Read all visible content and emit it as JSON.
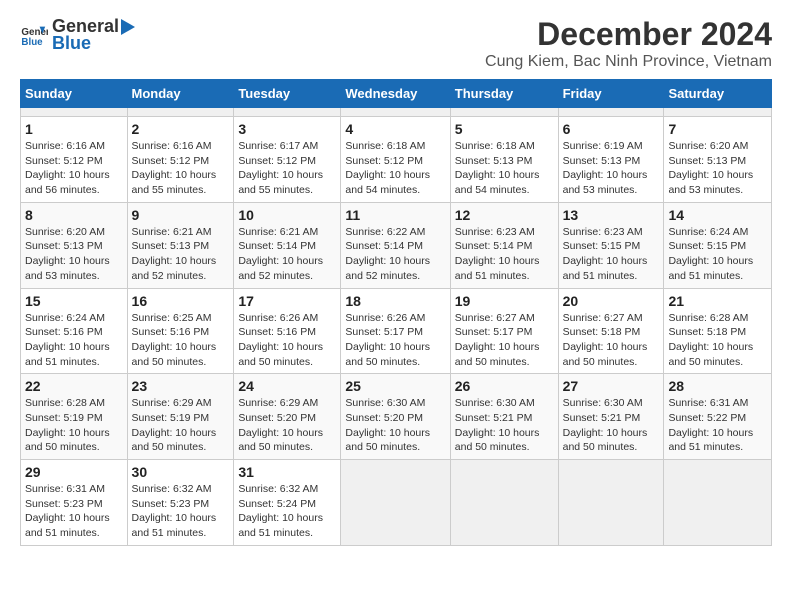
{
  "header": {
    "logo_general": "General",
    "logo_blue": "Blue",
    "title": "December 2024",
    "subtitle": "Cung Kiem, Bac Ninh Province, Vietnam"
  },
  "calendar": {
    "days_of_week": [
      "Sunday",
      "Monday",
      "Tuesday",
      "Wednesday",
      "Thursday",
      "Friday",
      "Saturday"
    ],
    "weeks": [
      [
        {
          "day": "",
          "empty": true
        },
        {
          "day": "",
          "empty": true
        },
        {
          "day": "",
          "empty": true
        },
        {
          "day": "",
          "empty": true
        },
        {
          "day": "",
          "empty": true
        },
        {
          "day": "",
          "empty": true
        },
        {
          "day": "",
          "empty": true
        }
      ],
      [
        {
          "day": "1",
          "sunrise": "6:16 AM",
          "sunset": "5:12 PM",
          "daylight": "10 hours and 56 minutes."
        },
        {
          "day": "2",
          "sunrise": "6:16 AM",
          "sunset": "5:12 PM",
          "daylight": "10 hours and 55 minutes."
        },
        {
          "day": "3",
          "sunrise": "6:17 AM",
          "sunset": "5:12 PM",
          "daylight": "10 hours and 55 minutes."
        },
        {
          "day": "4",
          "sunrise": "6:18 AM",
          "sunset": "5:12 PM",
          "daylight": "10 hours and 54 minutes."
        },
        {
          "day": "5",
          "sunrise": "6:18 AM",
          "sunset": "5:13 PM",
          "daylight": "10 hours and 54 minutes."
        },
        {
          "day": "6",
          "sunrise": "6:19 AM",
          "sunset": "5:13 PM",
          "daylight": "10 hours and 53 minutes."
        },
        {
          "day": "7",
          "sunrise": "6:20 AM",
          "sunset": "5:13 PM",
          "daylight": "10 hours and 53 minutes."
        }
      ],
      [
        {
          "day": "8",
          "sunrise": "6:20 AM",
          "sunset": "5:13 PM",
          "daylight": "10 hours and 53 minutes."
        },
        {
          "day": "9",
          "sunrise": "6:21 AM",
          "sunset": "5:13 PM",
          "daylight": "10 hours and 52 minutes."
        },
        {
          "day": "10",
          "sunrise": "6:21 AM",
          "sunset": "5:14 PM",
          "daylight": "10 hours and 52 minutes."
        },
        {
          "day": "11",
          "sunrise": "6:22 AM",
          "sunset": "5:14 PM",
          "daylight": "10 hours and 52 minutes."
        },
        {
          "day": "12",
          "sunrise": "6:23 AM",
          "sunset": "5:14 PM",
          "daylight": "10 hours and 51 minutes."
        },
        {
          "day": "13",
          "sunrise": "6:23 AM",
          "sunset": "5:15 PM",
          "daylight": "10 hours and 51 minutes."
        },
        {
          "day": "14",
          "sunrise": "6:24 AM",
          "sunset": "5:15 PM",
          "daylight": "10 hours and 51 minutes."
        }
      ],
      [
        {
          "day": "15",
          "sunrise": "6:24 AM",
          "sunset": "5:16 PM",
          "daylight": "10 hours and 51 minutes."
        },
        {
          "day": "16",
          "sunrise": "6:25 AM",
          "sunset": "5:16 PM",
          "daylight": "10 hours and 50 minutes."
        },
        {
          "day": "17",
          "sunrise": "6:26 AM",
          "sunset": "5:16 PM",
          "daylight": "10 hours and 50 minutes."
        },
        {
          "day": "18",
          "sunrise": "6:26 AM",
          "sunset": "5:17 PM",
          "daylight": "10 hours and 50 minutes."
        },
        {
          "day": "19",
          "sunrise": "6:27 AM",
          "sunset": "5:17 PM",
          "daylight": "10 hours and 50 minutes."
        },
        {
          "day": "20",
          "sunrise": "6:27 AM",
          "sunset": "5:18 PM",
          "daylight": "10 hours and 50 minutes."
        },
        {
          "day": "21",
          "sunrise": "6:28 AM",
          "sunset": "5:18 PM",
          "daylight": "10 hours and 50 minutes."
        }
      ],
      [
        {
          "day": "22",
          "sunrise": "6:28 AM",
          "sunset": "5:19 PM",
          "daylight": "10 hours and 50 minutes."
        },
        {
          "day": "23",
          "sunrise": "6:29 AM",
          "sunset": "5:19 PM",
          "daylight": "10 hours and 50 minutes."
        },
        {
          "day": "24",
          "sunrise": "6:29 AM",
          "sunset": "5:20 PM",
          "daylight": "10 hours and 50 minutes."
        },
        {
          "day": "25",
          "sunrise": "6:30 AM",
          "sunset": "5:20 PM",
          "daylight": "10 hours and 50 minutes."
        },
        {
          "day": "26",
          "sunrise": "6:30 AM",
          "sunset": "5:21 PM",
          "daylight": "10 hours and 50 minutes."
        },
        {
          "day": "27",
          "sunrise": "6:30 AM",
          "sunset": "5:21 PM",
          "daylight": "10 hours and 50 minutes."
        },
        {
          "day": "28",
          "sunrise": "6:31 AM",
          "sunset": "5:22 PM",
          "daylight": "10 hours and 51 minutes."
        }
      ],
      [
        {
          "day": "29",
          "sunrise": "6:31 AM",
          "sunset": "5:23 PM",
          "daylight": "10 hours and 51 minutes."
        },
        {
          "day": "30",
          "sunrise": "6:32 AM",
          "sunset": "5:23 PM",
          "daylight": "10 hours and 51 minutes."
        },
        {
          "day": "31",
          "sunrise": "6:32 AM",
          "sunset": "5:24 PM",
          "daylight": "10 hours and 51 minutes."
        },
        {
          "day": "",
          "empty": true
        },
        {
          "day": "",
          "empty": true
        },
        {
          "day": "",
          "empty": true
        },
        {
          "day": "",
          "empty": true
        }
      ]
    ]
  }
}
